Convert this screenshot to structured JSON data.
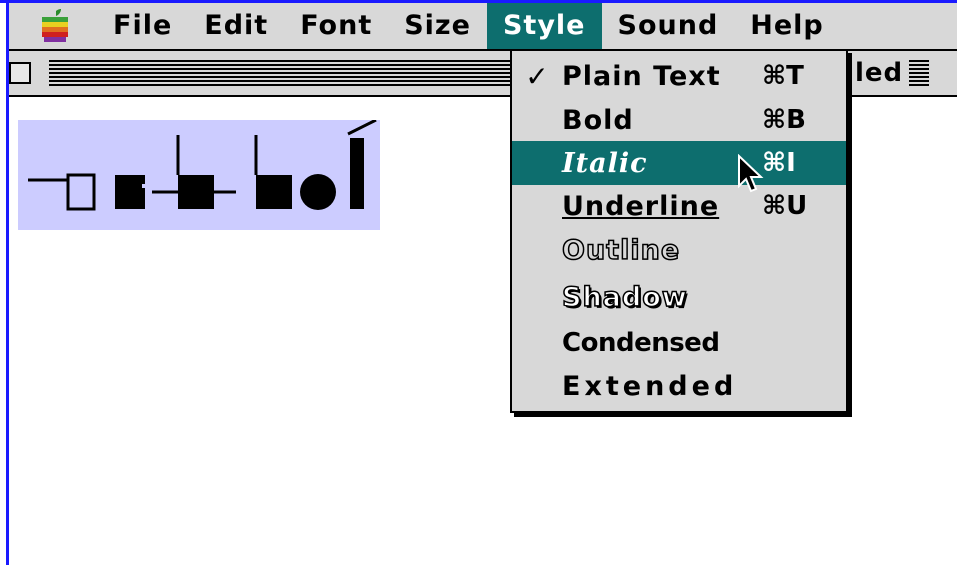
{
  "menubar": {
    "apple_icon": "apple-logo-icon",
    "items": [
      {
        "label": "File"
      },
      {
        "label": "Edit"
      },
      {
        "label": "Font"
      },
      {
        "label": "Size"
      },
      {
        "label": "Style"
      },
      {
        "label": "Sound"
      },
      {
        "label": "Help"
      }
    ]
  },
  "window": {
    "title_partial": "led"
  },
  "style_menu": {
    "items": [
      {
        "label": "Plain Text",
        "shortcut": "⌘T",
        "checked": "✓"
      },
      {
        "label": "Bold",
        "shortcut": "⌘B",
        "checked": ""
      },
      {
        "label": "Italic",
        "shortcut": "⌘I",
        "checked": ""
      },
      {
        "label": "Underline",
        "shortcut": "⌘U",
        "checked": ""
      },
      {
        "label": "Outline",
        "shortcut": "",
        "checked": ""
      },
      {
        "label": "Shadow",
        "shortcut": "",
        "checked": ""
      },
      {
        "label": "Condensed",
        "shortcut": "",
        "checked": ""
      },
      {
        "label": "Extended",
        "shortcut": "",
        "checked": ""
      }
    ]
  },
  "colors": {
    "menubar": "#d8d8d8",
    "highlight": "#0d6e6e",
    "selection": "#ccccff",
    "border": "#1a1aff"
  }
}
